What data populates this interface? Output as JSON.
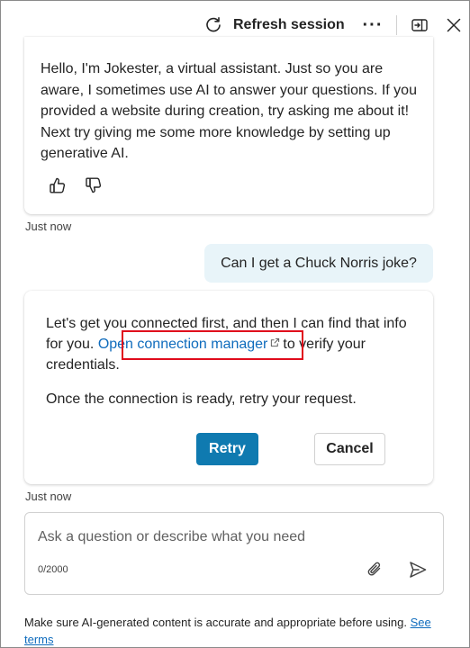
{
  "header": {
    "refresh_label": "Refresh session",
    "more_label": "···"
  },
  "messages": {
    "bot_greeting": "Hello, I'm Jokester, a virtual assistant. Just so you are aware, I sometimes use AI to answer your questions. If you provided a website during creation, try asking me about it! Next try giving me some more knowledge by setting up generative AI.",
    "greeting_time": "Just now",
    "user_message": "Can I get a Chuck Norris joke?",
    "connect_prefix": "Let's get you connected first, and then I can find that info for you.",
    "connect_link": "Open connection manager",
    "connect_suffix": "to verify your credentials.",
    "retry_hint": "Once the connection is ready, retry your request.",
    "retry_button": "Retry",
    "cancel_button": "Cancel",
    "connect_time": "Just now"
  },
  "composer": {
    "placeholder": "Ask a question or describe what you need",
    "char_count": "0/2000"
  },
  "disclaimer": {
    "text": "Make sure AI-generated content is accurate and appropriate before using.",
    "terms_link": "See terms"
  },
  "colors": {
    "accent": "#0f7ab0",
    "link": "#0f6cbd",
    "user_bubble": "#e8f4f9",
    "highlight_box": "#e00b1c"
  }
}
